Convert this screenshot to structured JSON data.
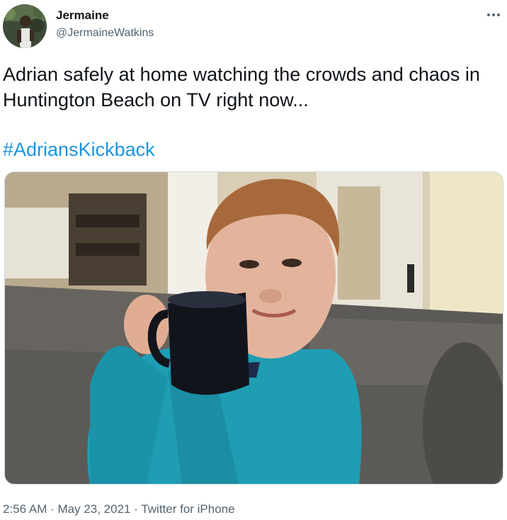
{
  "author": {
    "display_name": "Jermaine",
    "handle": "@JermaineWatkins",
    "avatar_icon": "profile-photo"
  },
  "more_icon": "more-dots-icon",
  "tweet": {
    "text": "Adrian safely at home watching the crowds and chaos in Huntington Beach on TV right now...",
    "hashtag": "#AdriansKickback"
  },
  "media": {
    "kind": "photo",
    "alt_icon": "photo-child-with-mug"
  },
  "meta": {
    "time": "2:56 AM",
    "separator": " · ",
    "date": "May 23, 2021",
    "source": "Twitter for iPhone"
  },
  "colors": {
    "link": "#1b95e0",
    "text": "#0f1419",
    "secondary": "#536471"
  }
}
